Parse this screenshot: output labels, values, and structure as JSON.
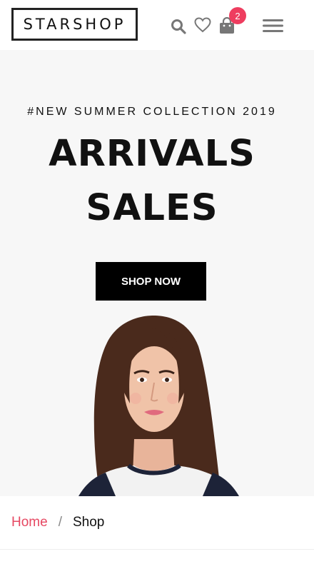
{
  "header": {
    "logo_text": "STARSHOP",
    "cart_count": "2",
    "icons": [
      "search-icon",
      "heart-icon",
      "shopping-bag-icon",
      "hamburger-menu-icon"
    ],
    "badge_color": "#ee3d5f"
  },
  "hero": {
    "eyebrow": "#NEW SUMMER COLLECTION 2019",
    "title_line_1": "ARRIVALS",
    "title_line_2": "SALES",
    "cta_label": "SHOP NOW",
    "background_color": "#f7f7f7"
  },
  "breadcrumb": {
    "home_label": "Home",
    "separator": "/",
    "current_label": "Shop",
    "link_color": "#e64862"
  }
}
